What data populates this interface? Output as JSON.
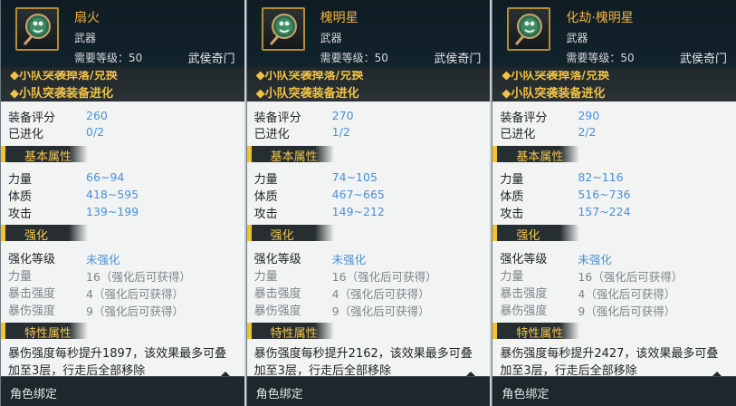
{
  "panels": [
    {
      "name": "扇火",
      "type": "武器",
      "level_label": "需要等级：50",
      "school": "武侯奇门",
      "links": [
        "◆小队突袭掉落/兑换",
        "◆小队突袭装备进化"
      ],
      "score_label": "装备评分",
      "score": "260",
      "evolve_label": "已进化",
      "evolve": "0/2",
      "sec_basic": "基本属性",
      "attrs": [
        {
          "label": "力量",
          "value": "66~94"
        },
        {
          "label": "体质",
          "value": "418~595"
        },
        {
          "label": "攻击",
          "value": "139~199"
        }
      ],
      "sec_enhance": "强化",
      "enh_level_label": "强化等级",
      "enh_level": "未强化",
      "enh": [
        {
          "label": "力量",
          "value": "16（强化后可获得）"
        },
        {
          "label": "暴击强度",
          "value": "4（强化后可获得）"
        },
        {
          "label": "暴伤强度",
          "value": "9（强化后可获得）"
        }
      ],
      "sec_special": "特性属性",
      "desc1": "暴伤强度每秒提升1897，该效果最多可叠",
      "desc2": "加至3层，行走后全部移除",
      "footer": "角色绑定"
    },
    {
      "name": "槐明星",
      "type": "武器",
      "level_label": "需要等级：50",
      "school": "武侯奇门",
      "links": [
        "◆小队突袭掉落/兑换",
        "◆小队突袭装备进化"
      ],
      "score_label": "装备评分",
      "score": "270",
      "evolve_label": "已进化",
      "evolve": "1/2",
      "sec_basic": "基本属性",
      "attrs": [
        {
          "label": "力量",
          "value": "74~105"
        },
        {
          "label": "体质",
          "value": "467~665"
        },
        {
          "label": "攻击",
          "value": "149~212"
        }
      ],
      "sec_enhance": "强化",
      "enh_level_label": "强化等级",
      "enh_level": "未强化",
      "enh": [
        {
          "label": "力量",
          "value": "16（强化后可获得）"
        },
        {
          "label": "暴击强度",
          "value": "4（强化后可获得）"
        },
        {
          "label": "暴伤强度",
          "value": "9（强化后可获得）"
        }
      ],
      "sec_special": "特性属性",
      "desc1": "暴伤强度每秒提升2162，该效果最多可叠",
      "desc2": "加至3层，行走后全部移除",
      "footer": "角色绑定"
    },
    {
      "name": "化劫·槐明星",
      "type": "武器",
      "level_label": "需要等级：50",
      "school": "武侯奇门",
      "links": [
        "◆小队突袭掉落/兑换",
        "◆小队突袭装备进化"
      ],
      "score_label": "装备评分",
      "score": "290",
      "evolve_label": "已进化",
      "evolve": "2/2",
      "sec_basic": "基本属性",
      "attrs": [
        {
          "label": "力量",
          "value": "82~116"
        },
        {
          "label": "体质",
          "value": "516~736"
        },
        {
          "label": "攻击",
          "value": "157~224"
        }
      ],
      "sec_enhance": "强化",
      "enh_level_label": "强化等级",
      "enh_level": "未强化",
      "enh": [
        {
          "label": "力量",
          "value": "16（强化后可获得）"
        },
        {
          "label": "暴击强度",
          "value": "4（强化后可获得）"
        },
        {
          "label": "暴伤强度",
          "value": "9（强化后可获得）"
        }
      ],
      "sec_special": "特性属性",
      "desc1": "暴伤强度每秒提升2427，该效果最多可叠",
      "desc2": "加至3层，行走后全部移除",
      "footer": "角色绑定"
    }
  ],
  "icons": {
    "item": "fan-weapon-icon",
    "link": "yellow-diamond-icon",
    "section": "section-tag-icon"
  },
  "colors": {
    "name": "#f0b240",
    "value": "#4b90d6",
    "section": "#f2c74d",
    "link": "#f0c245"
  }
}
